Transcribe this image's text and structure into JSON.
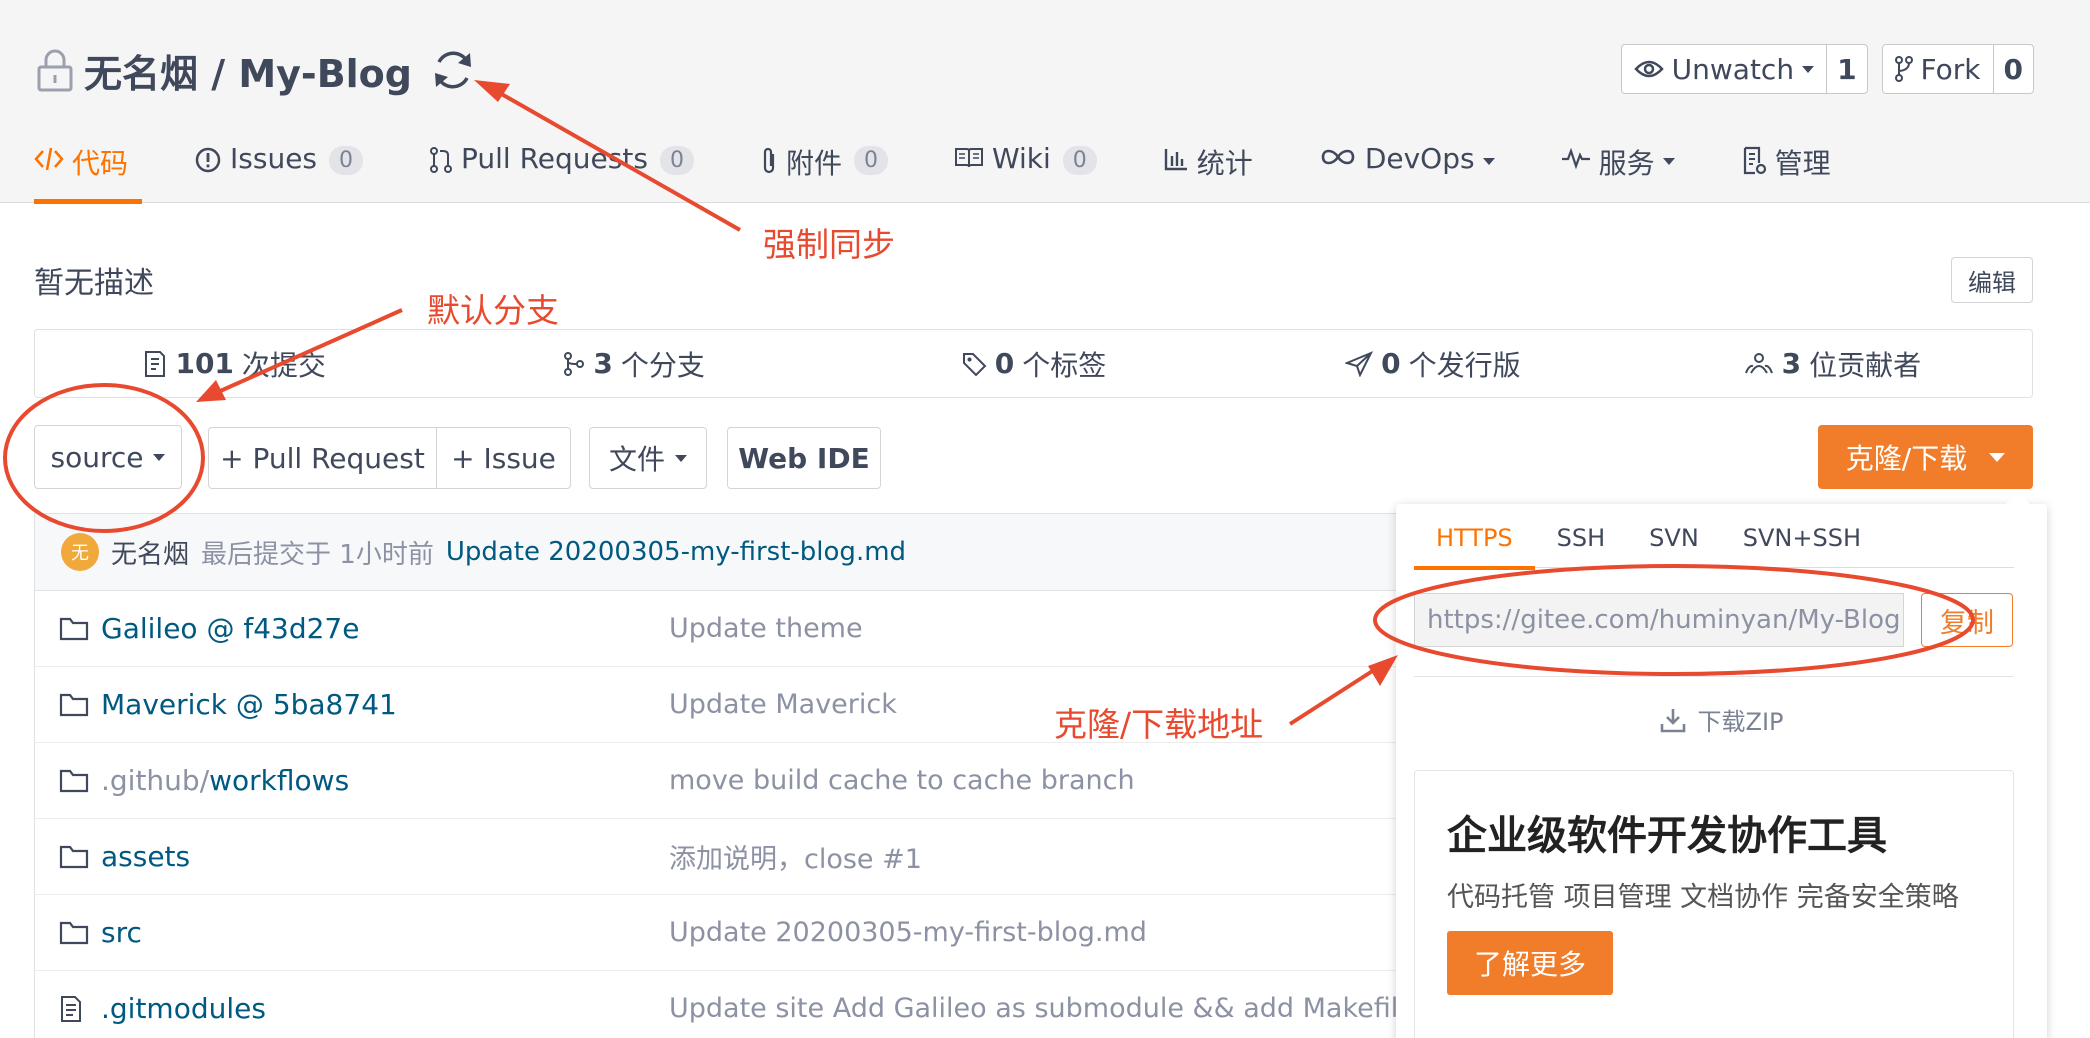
{
  "header": {
    "repo_name": "无名烟 / My-Blog",
    "unwatch_label": "Unwatch",
    "unwatch_count": "1",
    "fork_label": "Fork",
    "fork_count": "0"
  },
  "tabs": [
    {
      "label": "代码",
      "icon": "code-icon"
    },
    {
      "label": "Issues",
      "count": "0",
      "icon": "issue-icon"
    },
    {
      "label": "Pull Requests",
      "count": "0",
      "icon": "pull-request-icon"
    },
    {
      "label": "附件",
      "count": "0",
      "icon": "attachment-icon"
    },
    {
      "label": "Wiki",
      "count": "0",
      "icon": "wiki-icon"
    },
    {
      "label": "统计",
      "icon": "stats-icon"
    },
    {
      "label": "DevOps",
      "icon": "infinity-icon"
    },
    {
      "label": "服务",
      "icon": "pulse-icon"
    },
    {
      "label": "管理",
      "icon": "settings-doc-icon"
    }
  ],
  "description": "暂无描述",
  "edit_label": "编辑",
  "stats": [
    {
      "value": "101",
      "label": "次提交"
    },
    {
      "value": "3",
      "label": "个分支"
    },
    {
      "value": "0",
      "label": "个标签"
    },
    {
      "value": "0",
      "label": "个发行版"
    },
    {
      "value": "3",
      "label": "位贡献者"
    }
  ],
  "toolbar": {
    "branch": "source",
    "pull_request": "+ Pull Request",
    "issue": "+ Issue",
    "file": "文件",
    "web_ide": "Web IDE",
    "clone": "克隆/下载"
  },
  "last_commit": {
    "avatar_text": "无",
    "author": "无名烟",
    "meta": "最后提交于 1小时前",
    "message": "Update 20200305-my-first-blog.md"
  },
  "files": [
    {
      "name": "Galileo @ f43d27e",
      "prefix": "",
      "type": "folder",
      "message": "Update theme"
    },
    {
      "name": "Maverick @ 5ba8741",
      "prefix": "",
      "type": "folder",
      "message": "Update Maverick"
    },
    {
      "name": "workflows",
      "prefix": ".github/",
      "type": "folder",
      "message": "move build cache to cache branch"
    },
    {
      "name": "assets",
      "prefix": "",
      "type": "folder",
      "message": "添加说明，close #1"
    },
    {
      "name": "src",
      "prefix": "",
      "type": "folder",
      "message": "Update 20200305-my-first-blog.md"
    },
    {
      "name": ".gitmodules",
      "prefix": "",
      "type": "file",
      "message": "Update site Add Galileo as submodule && add Makefile"
    }
  ],
  "clone_panel": {
    "tabs": [
      "HTTPS",
      "SSH",
      "SVN",
      "SVN+SSH"
    ],
    "url": "https://gitee.com/huminyan/My-Blog.git",
    "copy": "复制",
    "download_zip": "下载ZIP",
    "promo_title": "企业级软件开发协作工具",
    "promo_sub": "代码托管 项目管理 文档协作 完备安全策略",
    "promo_button": "了解更多"
  },
  "annotations": {
    "force_sync": "强制同步",
    "default_branch": "默认分支",
    "clone_address": "克隆/下载地址"
  },
  "colors": {
    "accent": "#fe7300",
    "button": "#f17d2a",
    "annotation": "#e84a2f",
    "link": "#005980"
  }
}
